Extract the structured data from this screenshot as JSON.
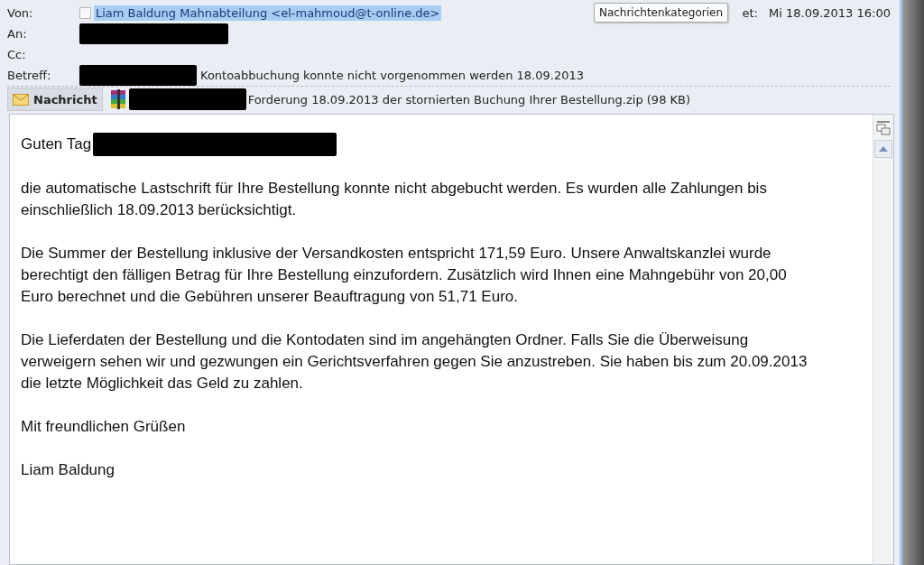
{
  "header": {
    "from": {
      "label": "Von:",
      "checked": false,
      "sender": "Liam Baldung Mahnabteilung <el-mahmoud@t-online.de>",
      "selected": true
    },
    "to": {
      "label": "An:",
      "redacted": true
    },
    "cc": {
      "label": "Cc:"
    },
    "subject": {
      "label": "Betreff:",
      "redacted": true,
      "value": "Kontoabbuchung konnte nicht vorgenommen werden 18.09.2013"
    },
    "sent": {
      "label": "et:",
      "value": "Mi 18.09.2013 16:00"
    },
    "tooltip": "Nachrichtenkategorien"
  },
  "tabs": [
    {
      "kind": "message",
      "label": "Nachricht",
      "selected": true
    },
    {
      "kind": "attachment",
      "redacted": true,
      "label": "Forderung 18.09.2013 der stornierten Buchung Ihrer Bestellung.zip (98 KB)",
      "selected": false
    }
  ],
  "body": {
    "greeting": "Guten Tag",
    "greeting_redacted": true,
    "paragraphs": [
      [
        "die automatische Lastschrift für Ihre Bestellung konnte nicht abgebucht werden. Es wurden alle Zahlungen bis",
        "einschließlich 18.09.2013 berücksichtigt."
      ],
      [
        "Die Summer der Bestellung inklusive der Versandkosten entspricht 171,59 Euro. Unsere Anwaltskanzlei wurde",
        "berechtigt den fälligen Betrag für Ihre Bestellung einzufordern. Zusätzlich wird Ihnen eine Mahngebühr von 20,00",
        "Euro berechnet und die Gebühren unserer Beauftragung von 51,71 Euro."
      ],
      [
        "Die Lieferdaten der Bestellung und die Kontodaten sind im angehängten Ordner. Falls Sie die Überweisung",
        "verweigern sehen wir und gezwungen ein Gerichtsverfahren gegen Sie anzustreben. Sie haben bis zum 20.09.2013",
        "die letzte Möglichkeit das Geld zu zahlen."
      ],
      [
        "Mit freundlichen Grüßen"
      ],
      [
        "Liam Baldung"
      ]
    ]
  }
}
